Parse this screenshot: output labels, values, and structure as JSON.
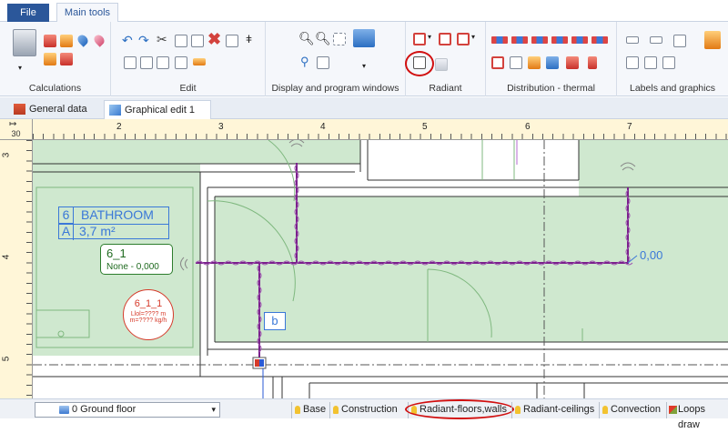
{
  "menu": {
    "file_label": "File",
    "main_tools_label": "Main tools"
  },
  "ribbon": {
    "groups": [
      {
        "label": "Calculations"
      },
      {
        "label": "Edit"
      },
      {
        "label": "Display and program windows"
      },
      {
        "label": "Radiant"
      },
      {
        "label": "Distribution - thermal"
      },
      {
        "label": "Labels and graphics"
      }
    ],
    "highlight_color": "#d10f0f"
  },
  "doc_tabs": [
    {
      "label": "General data",
      "icon": "table-icon"
    },
    {
      "label": "Graphical edit 1",
      "icon": "drawing-icon",
      "active": true,
      "close": "✕"
    }
  ],
  "rulers": {
    "scale": "30",
    "top_ticks": [
      "2",
      "3",
      "4",
      "5",
      "6",
      "7"
    ],
    "left_ticks": [
      "3",
      "4",
      "5"
    ]
  },
  "drawing": {
    "room_number": "6",
    "room_name": "BATHROOM",
    "area_label": "A",
    "area_value": "3,7 m²",
    "circuit_id": "6_1",
    "circuit_info": "None - 0,000",
    "device_id": "6_1_1",
    "device_line1": "Llol=???? m",
    "device_line2": "m=???? kg/h",
    "pipe_marker": "b",
    "dimension_value": "0,00",
    "pipe_color": "#7a1f8c",
    "room_fill_color": "#cfe8cf"
  },
  "status": {
    "floor": "0 Ground floor",
    "layers": [
      "Base",
      "Construction",
      "Radiant-floors,walls",
      "Radiant-ceilings",
      "Convection",
      "Loops draw"
    ]
  }
}
